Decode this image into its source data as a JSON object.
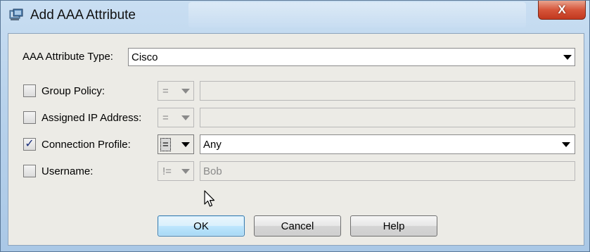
{
  "window": {
    "title": "Add AAA Attribute",
    "close_label": "X",
    "accent_color": "#aecbe6"
  },
  "attribute_type": {
    "label": "AAA Attribute Type:",
    "value": "Cisco"
  },
  "attributes": [
    {
      "key": "group_policy",
      "label": "Group Policy:",
      "checked": false,
      "operator": "=",
      "value": ""
    },
    {
      "key": "assigned_ip",
      "label": "Assigned IP Address:",
      "checked": false,
      "operator": "=",
      "value": ""
    },
    {
      "key": "connection_profile",
      "label": "Connection Profile:",
      "checked": true,
      "operator": "=",
      "value": "Any"
    },
    {
      "key": "username",
      "label": "Username:",
      "checked": false,
      "operator": "!=",
      "value": "Bob"
    }
  ],
  "buttons": {
    "ok": "OK",
    "cancel": "Cancel",
    "help": "Help"
  },
  "icons": {
    "app": "asdm-window-icon",
    "checkmark": "✓",
    "cursor": "mouse-pointer-icon"
  }
}
